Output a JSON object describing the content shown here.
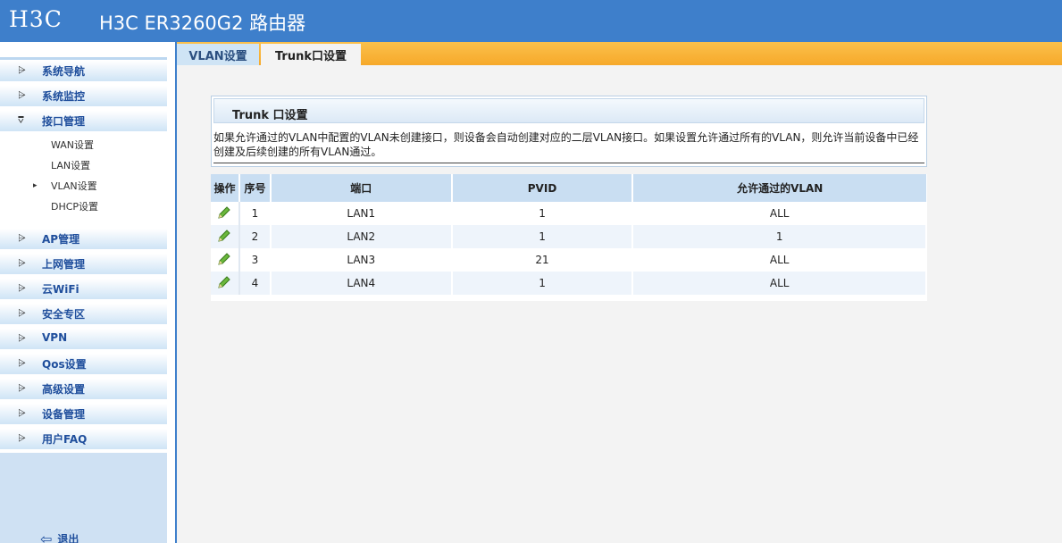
{
  "header": {
    "logo": "H3C",
    "title": "H3C ER3260G2 路由器"
  },
  "sidebar": {
    "items": [
      {
        "label": "系统导航"
      },
      {
        "label": "系统监控"
      },
      {
        "label": "接口管理",
        "expanded": true
      },
      {
        "label": "AP管理"
      },
      {
        "label": "上网管理"
      },
      {
        "label": "云WiFi"
      },
      {
        "label": "安全专区"
      },
      {
        "label": "VPN"
      },
      {
        "label": "Qos设置"
      },
      {
        "label": "高级设置"
      },
      {
        "label": "设备管理"
      },
      {
        "label": "用户FAQ"
      }
    ],
    "submenu": [
      {
        "label": "WAN设置"
      },
      {
        "label": "LAN设置"
      },
      {
        "label": "VLAN设置",
        "active": true
      },
      {
        "label": "DHCP设置"
      }
    ],
    "logout": "退出"
  },
  "tabs": [
    {
      "label": "VLAN设置"
    },
    {
      "label": "Trunk口设置",
      "active": true
    }
  ],
  "panel": {
    "title": "Trunk 口设置",
    "description": "如果允许通过的VLAN中配置的VLAN未创建接口，则设备会自动创建对应的二层VLAN接口。如果设置允许通过所有的VLAN，则允许当前设备中已经创建及后续创建的所有VLAN通过。"
  },
  "table": {
    "columns": [
      "操作",
      "序号",
      "端口",
      "PVID",
      "允许通过的VLAN"
    ],
    "rows": [
      {
        "index": "1",
        "port": "LAN1",
        "pvid": "1",
        "allowed_vlan": "ALL"
      },
      {
        "index": "2",
        "port": "LAN2",
        "pvid": "1",
        "allowed_vlan": "1"
      },
      {
        "index": "3",
        "port": "LAN3",
        "pvid": "21",
        "allowed_vlan": "ALL"
      },
      {
        "index": "4",
        "port": "LAN4",
        "pvid": "1",
        "allowed_vlan": "ALL"
      }
    ]
  },
  "icons": {
    "edit": "pencil-icon",
    "logout": "logout-icon",
    "menu_arrow": "arrow-icon"
  },
  "colors": {
    "header_bg": "#3e7fcb",
    "tab_bar_bg": "#f6a92a",
    "table_header_bg": "#c9def2",
    "menu_text": "#1f4e9c"
  }
}
